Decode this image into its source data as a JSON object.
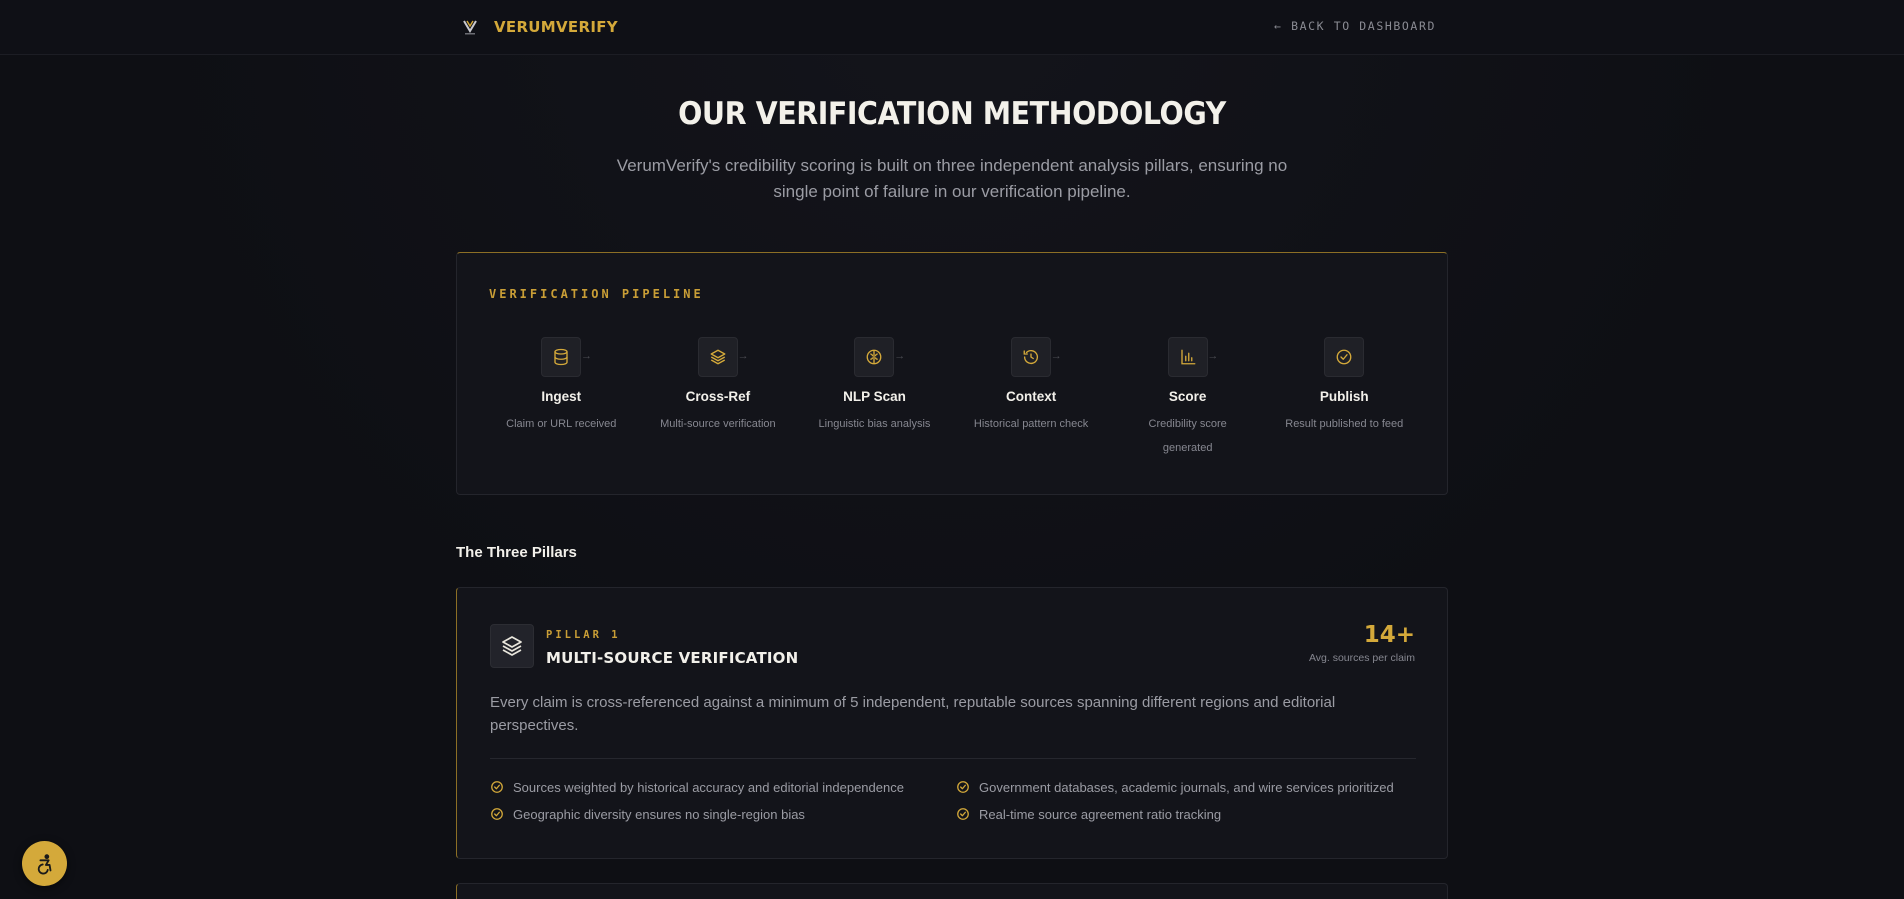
{
  "header": {
    "brand_name": "VERUMVERIFY",
    "back_link": "← BACK TO DASHBOARD"
  },
  "hero": {
    "title": "OUR VERIFICATION METHODOLOGY",
    "subtitle": "VerumVerify's credibility scoring is built on three independent analysis pillars, ensuring no single point of failure in our verification pipeline."
  },
  "pipeline": {
    "label": "VERIFICATION PIPELINE",
    "steps": [
      {
        "title": "Ingest",
        "desc": "Claim or URL received",
        "icon": "database-icon"
      },
      {
        "title": "Cross-Ref",
        "desc": "Multi-source verification",
        "icon": "layers-icon"
      },
      {
        "title": "NLP Scan",
        "desc": "Linguistic bias analysis",
        "icon": "brain-icon"
      },
      {
        "title": "Context",
        "desc": "Historical pattern check",
        "icon": "history-icon"
      },
      {
        "title": "Score",
        "desc": "Credibility score generated",
        "icon": "bar-chart-icon"
      },
      {
        "title": "Publish",
        "desc": "Result published to feed",
        "icon": "check-circle-icon"
      }
    ],
    "arrow": "→"
  },
  "section": {
    "title": "The Three Pillars"
  },
  "pillar1": {
    "kicker": "PILLAR 1",
    "title": "MULTI-SOURCE VERIFICATION",
    "stat_value": "14+",
    "stat_label": "Avg. sources per claim",
    "description": "Every claim is cross-referenced against a minimum of 5 independent, reputable sources spanning different regions and editorial perspectives.",
    "features": [
      "Sources weighted by historical accuracy and editorial independence",
      "Government databases, academic journals, and wire services prioritized",
      "Geographic diversity ensures no single-region bias",
      "Real-time source agreement ratio tracking"
    ]
  },
  "colors": {
    "accent": "#d4a93a",
    "background": "#0e0f14",
    "card": "#13141a"
  }
}
